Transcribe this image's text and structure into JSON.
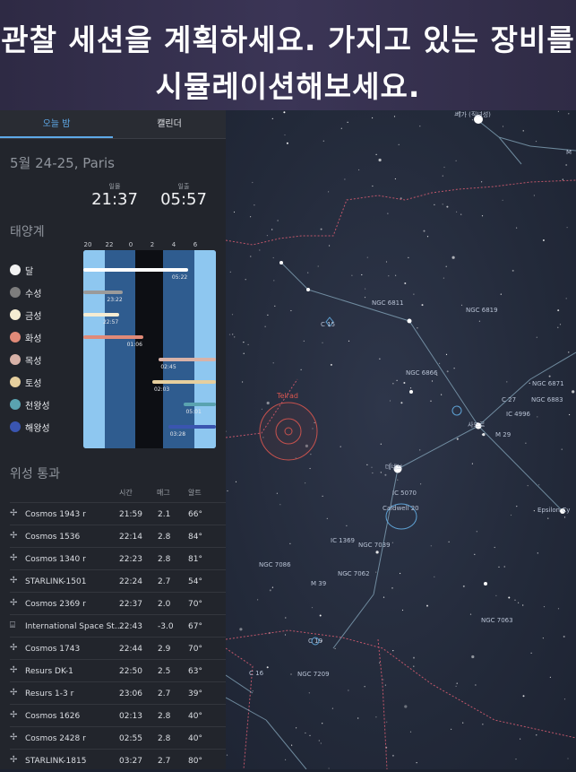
{
  "banner": {
    "line1": "관찰 세션을 계획하세요. 가지고 있는 장비를",
    "line2": "시뮬레이션해보세요."
  },
  "tabs": {
    "tonight": "오늘 밤",
    "calendar": "캘린더"
  },
  "date_location": "5월 24-25, Paris",
  "sun": {
    "sunset_label": "일몰",
    "sunset_time": "21:37",
    "sunrise_label": "일출",
    "sunrise_time": "05:57"
  },
  "solar_system": {
    "title": "태양계",
    "hours": [
      "20",
      "22",
      "0",
      "2",
      "4",
      "6"
    ],
    "planets": [
      {
        "name": "달",
        "color": "#f2f2f2",
        "bar_start": 0.0,
        "bar_end": 0.79,
        "bar_color": "#ffffff",
        "time": "05:22",
        "time_side": "end"
      },
      {
        "name": "수성",
        "color": "#7d7d7d",
        "bar_start": 0.0,
        "bar_end": 0.3,
        "bar_color": "#9a9a9a",
        "time": "23:22",
        "time_side": "end"
      },
      {
        "name": "금성",
        "color": "#f5ecd2",
        "bar_start": 0.0,
        "bar_end": 0.27,
        "bar_color": "#f5ecd2",
        "time": "22:57",
        "time_side": "end"
      },
      {
        "name": "화성",
        "color": "#e08a78",
        "bar_start": 0.0,
        "bar_end": 0.45,
        "bar_color": "#e08a78",
        "time": "01:06",
        "time_side": "end"
      },
      {
        "name": "목성",
        "color": "#d8b2a8",
        "bar_start": 0.57,
        "bar_end": 1.0,
        "bar_color": "#d8b2a8",
        "time": "02:45",
        "time_side": "start"
      },
      {
        "name": "토성",
        "color": "#e6cf9e",
        "bar_start": 0.52,
        "bar_end": 1.0,
        "bar_color": "#e6cf9e",
        "time": "02:03",
        "time_side": "start"
      },
      {
        "name": "천왕성",
        "color": "#5aa3b0",
        "bar_start": 0.76,
        "bar_end": 1.0,
        "bar_color": "#5aa3b0",
        "time": "05:01",
        "time_side": "start"
      },
      {
        "name": "해왕성",
        "color": "#3a55b0",
        "bar_start": 0.64,
        "bar_end": 1.0,
        "bar_color": "#3a55b0",
        "time": "03:28",
        "time_side": "start"
      }
    ]
  },
  "satellites": {
    "title": "위성 통과",
    "columns": [
      "시간",
      "매그",
      "알트"
    ],
    "rows": [
      {
        "name": "Cosmos 1943 r",
        "time": "21:59",
        "mag": "2.1",
        "alt": "66°",
        "icon": "satellite-icon"
      },
      {
        "name": "Cosmos 1536",
        "time": "22:14",
        "mag": "2.8",
        "alt": "84°",
        "icon": "satellite-icon"
      },
      {
        "name": "Cosmos 1340 r",
        "time": "22:23",
        "mag": "2.8",
        "alt": "81°",
        "icon": "satellite-icon"
      },
      {
        "name": "STARLINK-1501",
        "time": "22:24",
        "mag": "2.7",
        "alt": "54°",
        "icon": "satellite-icon"
      },
      {
        "name": "Cosmos 2369 r",
        "time": "22:37",
        "mag": "2.0",
        "alt": "70°",
        "icon": "satellite-icon"
      },
      {
        "name": "International Space St...",
        "time": "22:43",
        "mag": "-3.0",
        "alt": "67°",
        "icon": "space-station-icon"
      },
      {
        "name": "Cosmos 1743",
        "time": "22:44",
        "mag": "2.9",
        "alt": "70°",
        "icon": "satellite-icon"
      },
      {
        "name": "Resurs DK-1",
        "time": "22:50",
        "mag": "2.5",
        "alt": "63°",
        "icon": "satellite-icon"
      },
      {
        "name": "Resurs 1-3 r",
        "time": "23:06",
        "mag": "2.7",
        "alt": "39°",
        "icon": "satellite-icon"
      },
      {
        "name": "Cosmos 1626",
        "time": "02:13",
        "mag": "2.8",
        "alt": "40°",
        "icon": "satellite-icon"
      },
      {
        "name": "Cosmos 2428 r",
        "time": "02:55",
        "mag": "2.8",
        "alt": "40°",
        "icon": "satellite-icon"
      },
      {
        "name": "STARLINK-1815",
        "time": "03:27",
        "mag": "2.7",
        "alt": "80°",
        "icon": "satellite-icon"
      }
    ]
  },
  "sky_map": {
    "telrad_label": "Telrad",
    "labels": {
      "vega": "베가 (직녀성)",
      "ngc6811": "NGC 6811",
      "ngc6819": "NGC 6819",
      "c15": "C 15",
      "ngc6866": "NGC 6866",
      "ngc6871": "NGC 6871",
      "ngc6883": "NGC 6883",
      "c27": "C 27",
      "ic4996": "IC 4996",
      "sadr": "사드르",
      "m29": "M 29",
      "deneb": "데네브",
      "ic5070": "IC 5070",
      "caldwell20": "Caldwell 20",
      "epsilon": "Epsilon Cy",
      "ic1369": "IC 1369",
      "ngc7039": "NGC 7039",
      "ngc7086": "NGC 7086",
      "ngc7062": "NGC 7062",
      "m39": "M 39",
      "ngc7063": "NGC 7063",
      "c19": "C 19",
      "c16": "C 16",
      "ngc7209": "NGC 7209",
      "m_edge": "M"
    },
    "colors": {
      "constellation_line": "#8fb3c8",
      "boundary": "#c0566a",
      "telrad": "#d9564f",
      "labels": "#b8c2d4"
    }
  }
}
